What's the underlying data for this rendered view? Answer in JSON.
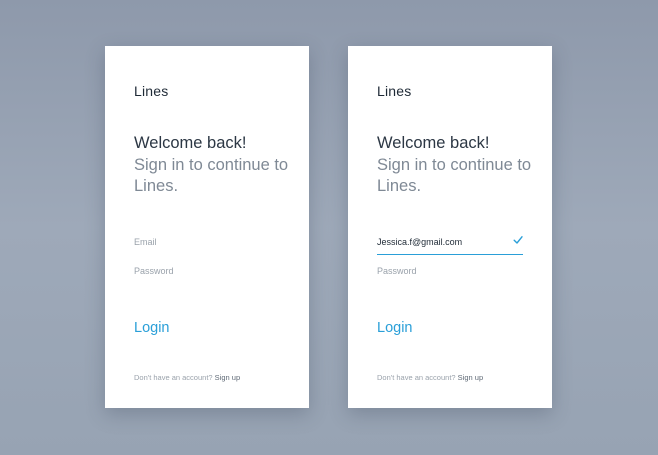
{
  "cards": [
    {
      "brand": "Lines",
      "headline": "Welcome back!",
      "subheadline": "Sign in to continue to Lines.",
      "email_placeholder": "Email",
      "password_placeholder": "Password",
      "login_label": "Login",
      "footer_text": "Don't have an account?",
      "signup_label": "Sign up"
    },
    {
      "brand": "Lines",
      "headline": "Welcome back!",
      "subheadline": "Sign in to continue to Lines.",
      "email_value": "Jessica.f@gmail.com",
      "email_valid_icon": "checkmark-icon",
      "password_placeholder": "Password",
      "login_label": "Login",
      "footer_text": "Don't have an account?",
      "signup_label": "Sign up"
    }
  ],
  "colors": {
    "accent": "#2a9fd8",
    "text_dark": "#2c3744",
    "text_muted": "#7f8995",
    "placeholder": "#9aa2ab",
    "background": "#97a3b3"
  }
}
